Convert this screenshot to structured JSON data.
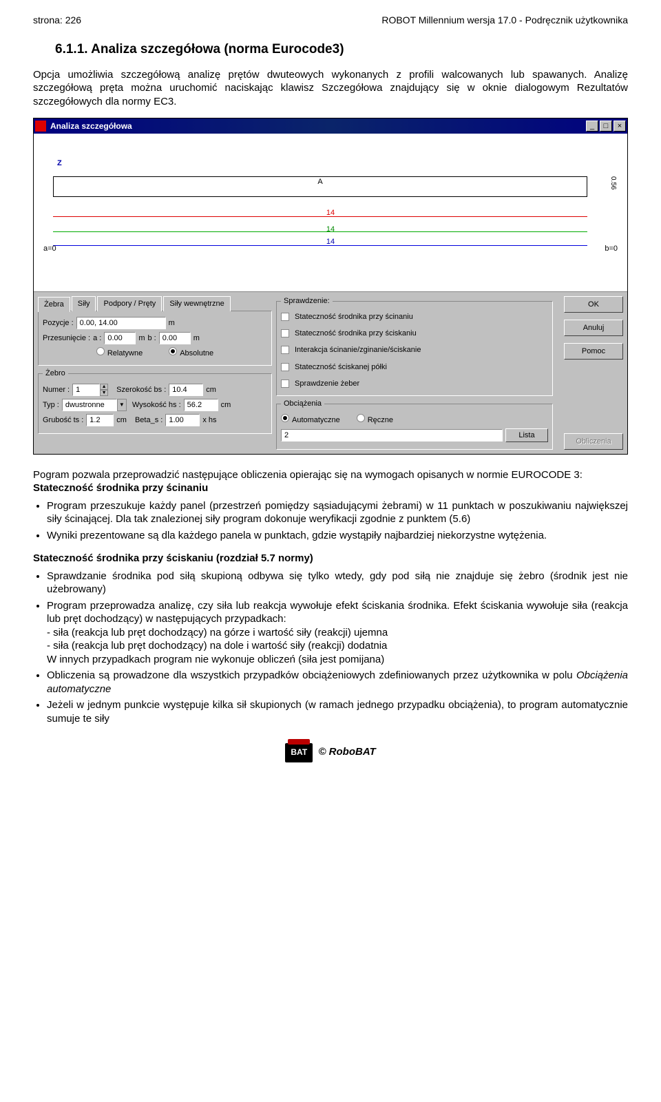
{
  "header": {
    "left": "strona: 226",
    "right": "ROBOT Millennium wersja 17.0 - Podręcznik użytkownika"
  },
  "heading": "6.1.1.   Analiza szczegółowa (norma Eurocode3)",
  "intro": "Opcja umożliwia szczegółową analizę prętów dwuteowych wykonanych z profili walcowanych lub spawanych. Analizę szczegółową pręta można uruchomić naciskając klawisz Szczegółowa znajdujący się w oknie dialogowym Rezultatów szczegółowych dla normy EC3.",
  "window": {
    "title": "Analiza szczegółowa",
    "diagramLabel": "A",
    "zlabel": "Z",
    "dim14": "14",
    "dimSide": "0.56",
    "a0": "a=0",
    "b0": "b=0",
    "tabs": [
      "Żebra",
      "Siły",
      "Podpory / Pręty",
      "Siły wewnętrzne"
    ],
    "zebra": {
      "pozycjeLabel": "Pozycje :",
      "pozycje": "0.00, 14.00",
      "m": "m",
      "przesLabel": "Przesunięcie :",
      "aLabel": "a :",
      "a": "0.00",
      "bLabel": "b :",
      "b": "0.00",
      "rel": "Relatywne",
      "abs": "Absolutne"
    },
    "zebro": {
      "legend": "Żebro",
      "numerLabel": "Numer :",
      "numer": "1",
      "szerLabel": "Szerokość bs :",
      "szer": "10.4",
      "cm": "cm",
      "typLabel": "Typ :",
      "typ": "dwustronne",
      "wysLabel": "Wysokość hs :",
      "wys": "56.2",
      "grubLabel": "Grubość ts :",
      "grub": "1.2",
      "betaLabel": "Beta_s :",
      "beta": "1.00",
      "xhs": "x hs"
    },
    "spr": {
      "legend": "Sprawdzenie:",
      "items": [
        "Stateczność środnika przy ścinaniu",
        "Stateczność środnika przy ściskaniu",
        "Interakcja ścinanie/zginanie/ściskanie",
        "Stateczność ściskanej półki",
        "Sprawdzenie żeber"
      ]
    },
    "obc": {
      "legend": "Obciążenia",
      "auto": "Automatyczne",
      "recz": "Ręczne",
      "field": "2",
      "lista": "Lista"
    },
    "buttons": {
      "ok": "OK",
      "anuluj": "Anuluj",
      "pomoc": "Pomoc",
      "obl": "Obliczenia"
    }
  },
  "after1_lead": "Pogram pozwala przeprowadzić następujące obliczenia opierając się na wymogach opisanych w normie EUROCODE 3:",
  "after1_sub": "Stateczność środnika przy ścinaniu",
  "after1_b1": "Program przeszukuje każdy panel (przestrzeń pomiędzy sąsiadującymi żebrami) w 11 punktach w poszukiwaniu największej siły ścinającej. Dla tak znalezionej siły program dokonuje weryfikacji zgodnie z punktem (5.6)",
  "after1_b2": "Wyniki prezentowane są dla każdego panela w punktach, gdzie wystąpiły najbardziej niekorzystne wytężenia.",
  "sec2_head": "Stateczność środnika przy ściskaniu (rozdział 5.7 normy)",
  "sec2_b1": "Sprawdzanie środnika pod siłą skupioną odbywa się tylko wtedy, gdy pod siłą nie znajduje się żebro (środnik jest nie użebrowany)",
  "sec2_b2a": "Program przeprowadza analizę, czy siła lub reakcja wywołuje efekt ściskania środnika. Efekt ściskania wywołuje siła (reakcja lub pręt dochodzący) w następujących przypadkach:",
  "sec2_b2b": "- siła (reakcja lub pręt dochodzący) na górze i wartość siły (reakcji) ujemna",
  "sec2_b2c": "- siła (reakcja lub pręt dochodzący) na dole i wartość siły (reakcji) dodatnia",
  "sec2_b2d": "W innych przypadkach program nie wykonuje obliczeń (siła jest pomijana)",
  "sec2_b3a": "Obliczenia są prowadzone dla wszystkich przypadków obciążeniowych zdefiniowanych przez użytkownika w polu ",
  "sec2_b3b": "Obciążenia automatyczne",
  "sec2_b4": "Jeżeli w jednym punkcie występuje kilka sił skupionych (w ramach jednego przypadku obciążenia), to program automatycznie sumuje te siły",
  "footer": {
    "logo": "BAT",
    "text": "© RoboBAT"
  }
}
